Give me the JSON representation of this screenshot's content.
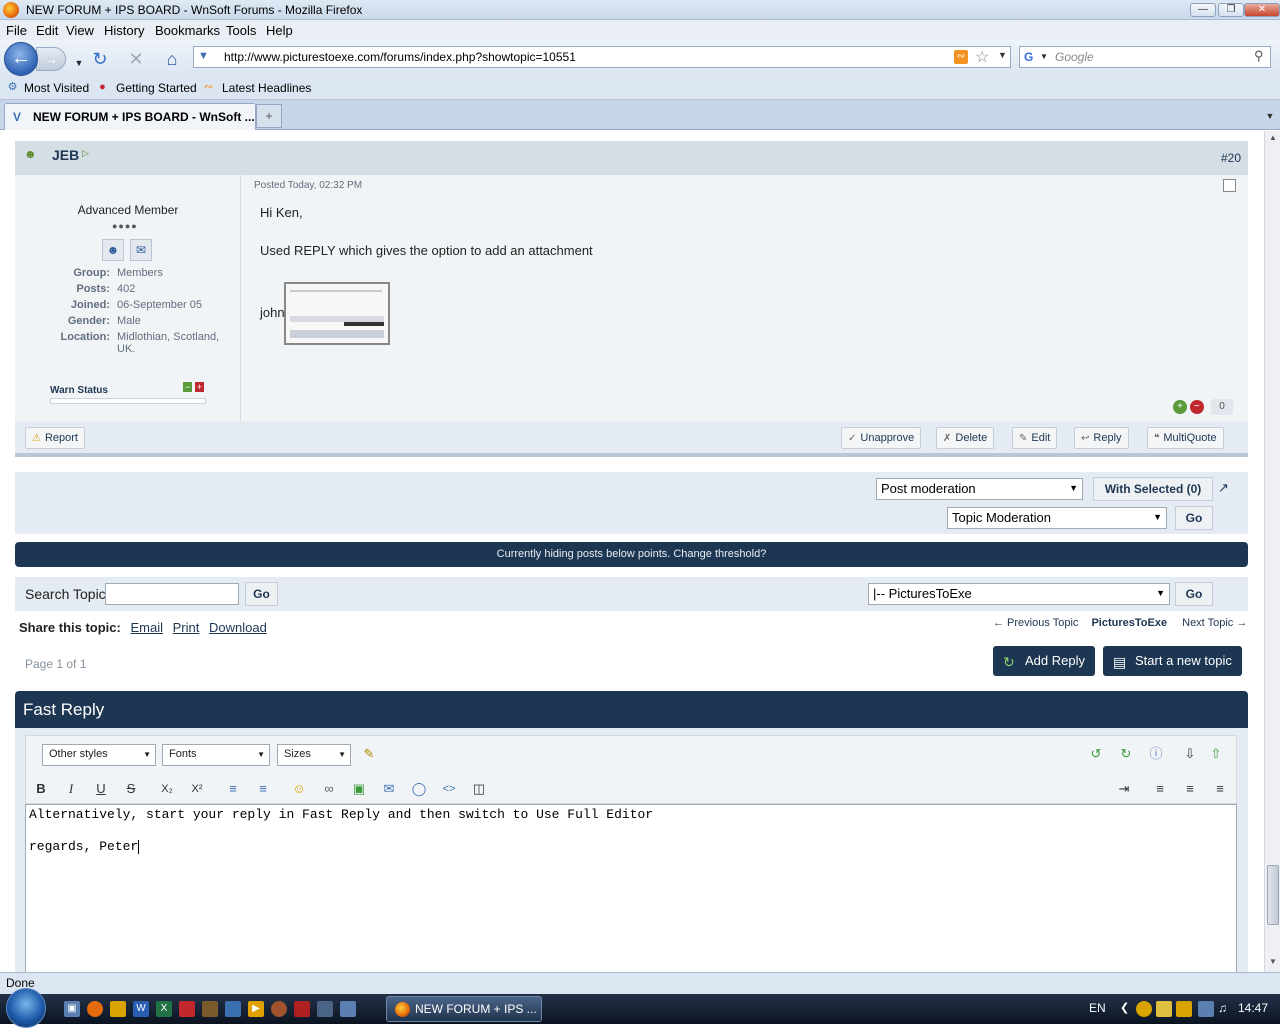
{
  "window": {
    "title": "NEW FORUM + IPS BOARD - WnSoft Forums - Mozilla Firefox",
    "controls": [
      "—",
      "❐",
      "✕"
    ]
  },
  "menu": [
    "File",
    "Edit",
    "View",
    "History",
    "Bookmarks",
    "Tools",
    "Help"
  ],
  "nav": {
    "url": "http://www.picturestoexe.com/forums/index.php?showtopic=10551",
    "search_placeholder": "Google"
  },
  "bookmarks": [
    "Most Visited",
    "Getting Started",
    "Latest Headlines"
  ],
  "tab": {
    "label": "NEW FORUM + IPS BOARD - WnSoft ..."
  },
  "post": {
    "author": "JEB",
    "number": "#20",
    "rank": "Advanced Member",
    "pips": "●●●●",
    "fields": [
      {
        "k": "Group:",
        "v": "Members"
      },
      {
        "k": "Posts:",
        "v": "402"
      },
      {
        "k": "Joined:",
        "v": "06-September 05"
      },
      {
        "k": "Gender:",
        "v": "Male"
      },
      {
        "k": "Location:",
        "v": "Midlothian, Scotland, UK."
      }
    ],
    "warn_label": "Warn Status",
    "posted": "Posted Today, 02:32 PM",
    "greeting": "Hi Ken,",
    "body": "Used REPLY which gives the option to add an attachment",
    "signoff": "john",
    "rep_count": "0",
    "report": "Report",
    "actions": [
      "Unapprove",
      "Delete",
      "Edit",
      "Reply",
      "MultiQuote"
    ]
  },
  "moderation": {
    "post_mod": "Post moderation",
    "with_selected": "With Selected (0)",
    "topic_mod": "Topic Moderation",
    "go": "Go"
  },
  "hide_notice": "Currently hiding posts below points. Change threshold?",
  "search": {
    "label": "Search Topic",
    "go": "Go",
    "forum": "|-- PicturesToExe"
  },
  "share": {
    "label": "Share this topic:",
    "links": [
      "Email",
      "Print",
      "Download"
    ]
  },
  "topic_nav": {
    "prev": "← Previous Topic",
    "current": "PicturesToExe",
    "next": "Next Topic →"
  },
  "page_of": "Page 1 of 1",
  "buttons": {
    "add_reply": "Add Reply",
    "new_topic": "Start a new topic"
  },
  "fast_reply": {
    "title": "Fast Reply",
    "styles": "Other styles",
    "fonts": "Fonts",
    "sizes": "Sizes",
    "line1": "Alternatively, start your reply in Fast Reply and then switch to Use Full Editor",
    "line2": "regards, Peter"
  },
  "status": "Done",
  "taskbar": {
    "task": "NEW FORUM + IPS ...",
    "lang": "EN",
    "time": "14:47"
  }
}
